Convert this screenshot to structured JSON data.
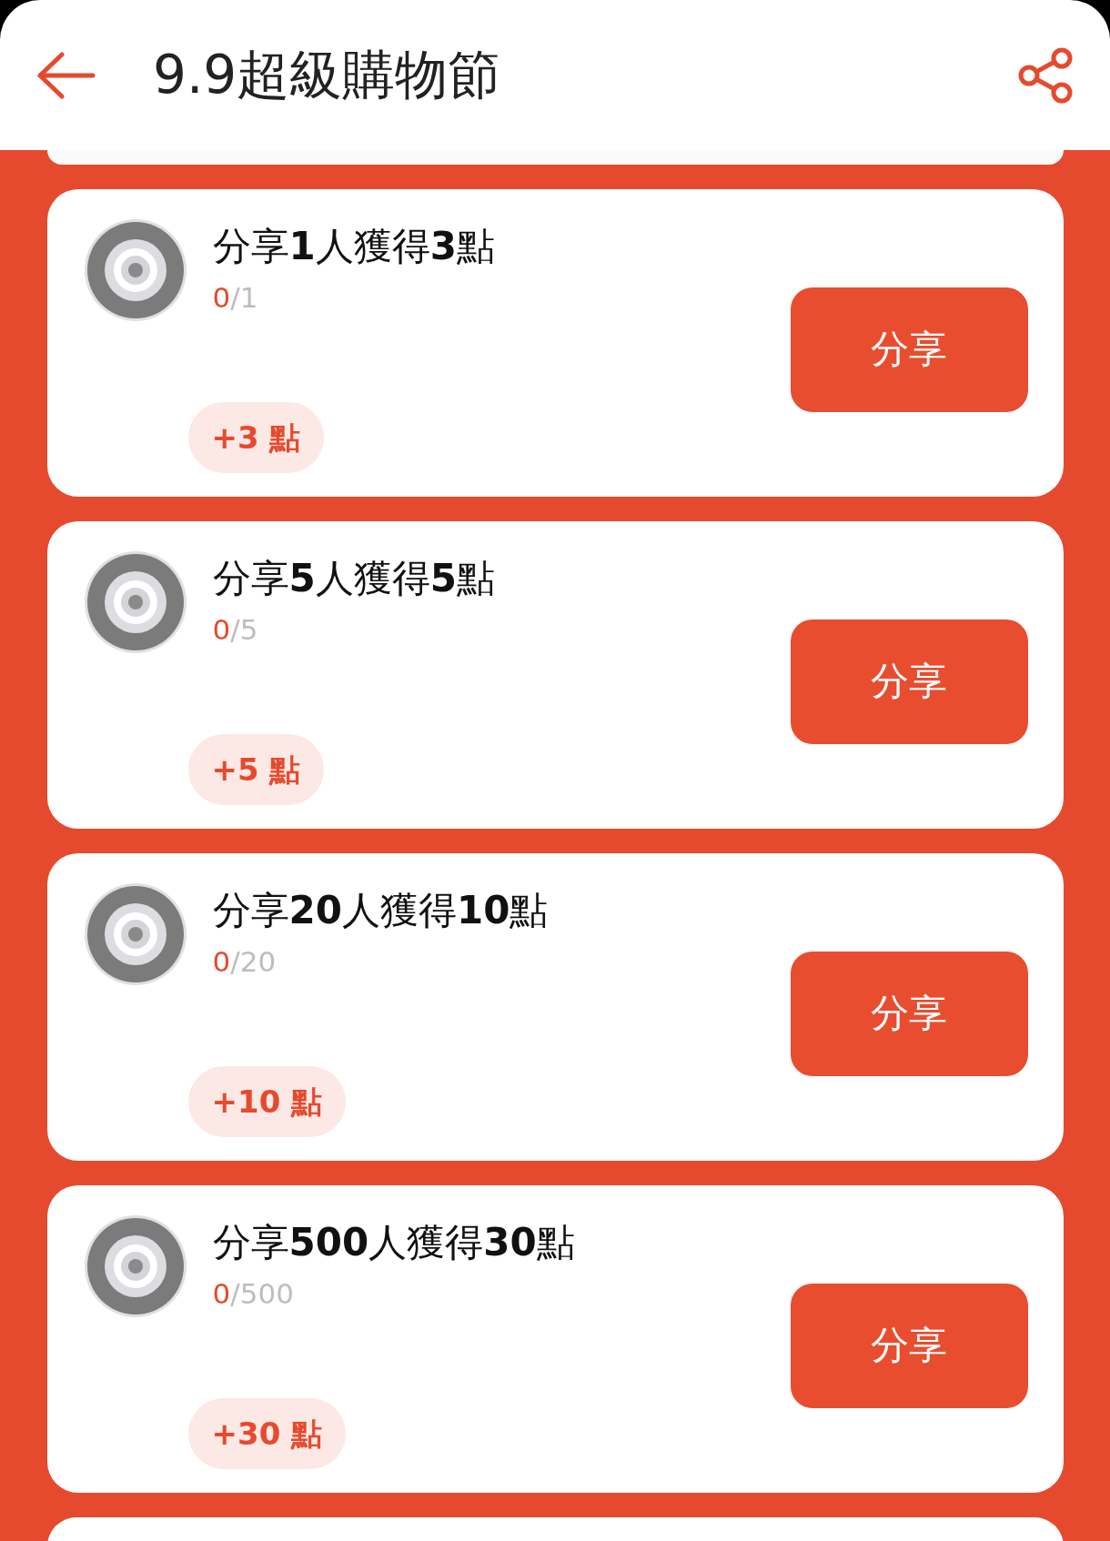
{
  "header": {
    "title": "9.9超級購物節"
  },
  "tasks": [
    {
      "title": "分享**1**人獲得**3**點",
      "done": "0",
      "total": "/1",
      "reward": "+3 點",
      "button": "分享"
    },
    {
      "title": "分享**5**人獲得**5**點",
      "done": "0",
      "total": "/5",
      "reward": "+5 點",
      "button": "分享"
    },
    {
      "title": "分享**20**人獲得**10**點",
      "done": "0",
      "total": "/20",
      "reward": "+10 點",
      "button": "分享"
    },
    {
      "title": "分享**500**人獲得**30**點",
      "done": "0",
      "total": "/500",
      "reward": "+30 點",
      "button": "分享"
    }
  ]
}
